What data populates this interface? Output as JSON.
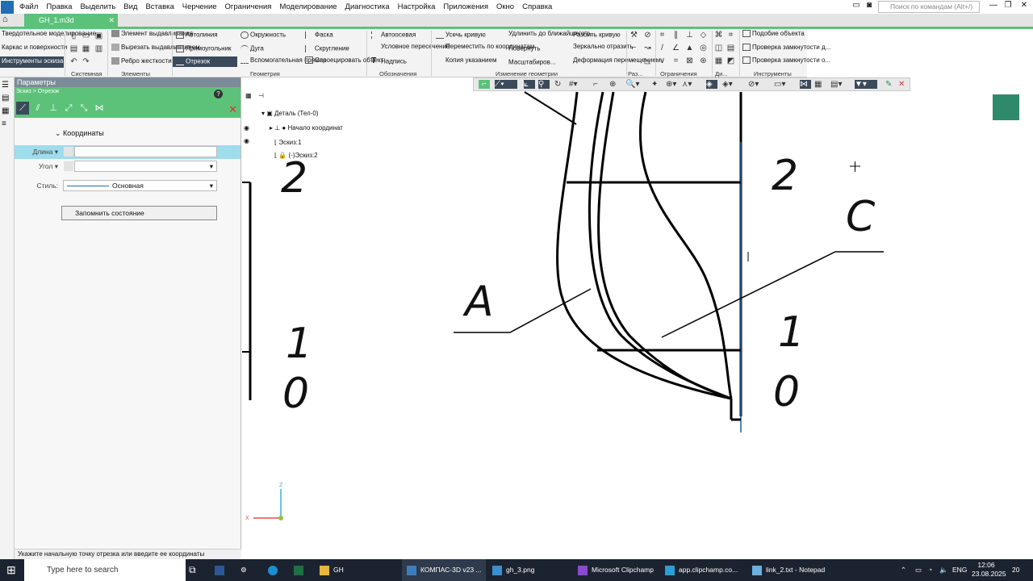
{
  "menu": {
    "items": [
      "Файл",
      "Правка",
      "Выделить",
      "Вид",
      "Вставка",
      "Черчение",
      "Ограничения",
      "Моделирование",
      "Диагностика",
      "Настройка",
      "Приложения",
      "Окно",
      "Справка"
    ],
    "search_placeholder": "Поиск по командам (Alt+/)"
  },
  "tab": {
    "doc_name": "GH_1.m3d"
  },
  "ribbon": {
    "modes": [
      "Твердотельное моделирование",
      "Каркас и поверхности",
      "Инструменты эскиза"
    ],
    "elements": [
      "Элемент выдавливания",
      "Вырезать выдавливанием",
      "Ребро жесткости"
    ],
    "geometry": [
      "Автолиния",
      "Прямоугольник",
      "Отрезок",
      "Окружность",
      "Дуга",
      "Вспомогательная прямая",
      "Фаска",
      "Скругление",
      "Спроецировать объект"
    ],
    "notation": [
      "Автоосевая",
      "Условное пересечение",
      "Надпись"
    ],
    "edit": [
      "Усечь кривую",
      "Переместить по координатам",
      "Копия указанием",
      "Удлинить до ближайшего о...",
      "Повернуть",
      "Масштабиров...",
      "Разбить кривую",
      "Зеркально отразить",
      "Деформация перемещением"
    ],
    "tools": [
      "Подобие объекта",
      "Проверка замкнутости д...",
      "Проверка замкнутости о..."
    ],
    "captions": [
      "Системная",
      "Элементы",
      "Геометрия",
      "Обозначения",
      "Изменение геометрии",
      "Раз...",
      "Ограничения",
      "Ди...",
      "Инструменты"
    ]
  },
  "params": {
    "title": "Параметры",
    "breadcrumb": "Эскиз > Отрезок",
    "section": "Координаты",
    "length_label": "Длина",
    "angle_label": "Угол",
    "style_label": "Стиль:",
    "style_value": "Основная",
    "save_state": "Запомнить состояние",
    "status": "Укажите начальную точку отрезка или введите ее координаты"
  },
  "tree": {
    "root": "Деталь (Тел-0)",
    "origin": "Начало координат",
    "sketch1": "Эскиз:1",
    "sketch2": "(-)Эскиз:2"
  },
  "drawing_labels": {
    "two_left": "2",
    "one_left": "1",
    "zero_left": "0",
    "two_right": "2",
    "one_right": "1",
    "zero_right": "0",
    "a": "A",
    "c": "C",
    "axis_z": "Z",
    "axis_x": "X"
  },
  "taskbar": {
    "search": "Type here to search",
    "apps": [
      "GH",
      "КОМПАС-3D v23 ...",
      "gh_3.png",
      "Microsoft Clipchamp",
      "app.clipchamp.co...",
      "link_2.txt - Notepad"
    ],
    "lang": "ENG",
    "time": "12:06",
    "date": "23.08.2025",
    "badge": "20"
  }
}
